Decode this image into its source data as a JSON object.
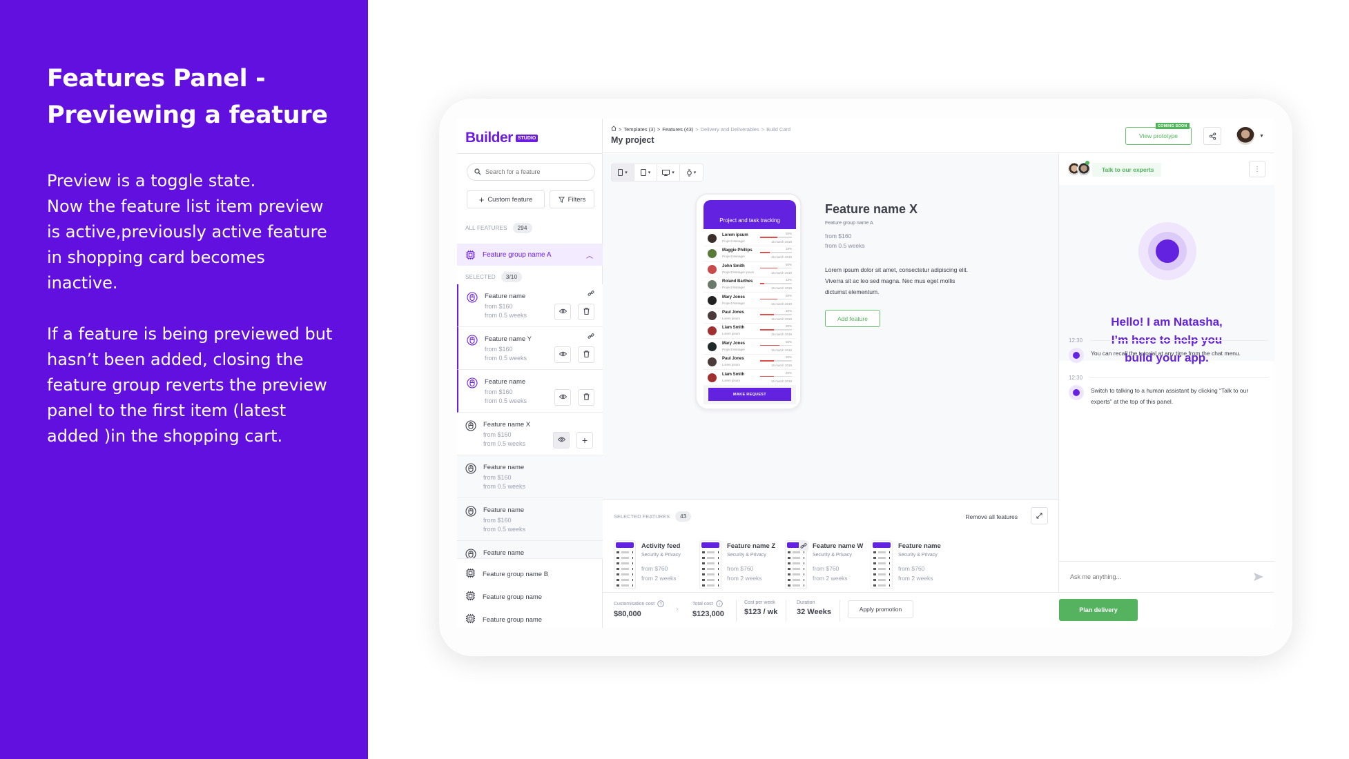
{
  "slide": {
    "title": "Features Panel - Previewing a feature",
    "paragraph1": "Preview is a toggle state.\nNow the feature list item preview is active,previously active feature in shopping card becomes inactive.",
    "paragraph2": "If a feature is being previewed but hasn’t been added, closing the feature group reverts the preview panel to the first item (latest added )in the shopping cart."
  },
  "brand": {
    "logo_text": "Builder",
    "logo_badge": "STUDIO",
    "accent": "#6c1ee0",
    "green": "#55b35f"
  },
  "header": {
    "breadcrumb": [
      "Templates (3)",
      "Features (43)",
      "Delivery and Deliverables",
      "Build Card"
    ],
    "project_title": "My project",
    "view_prototype": "View prototype",
    "coming_soon": "COMING SOON"
  },
  "sidebar": {
    "search_placeholder": "Search for a feature",
    "custom_feature": "Custom feature",
    "filters": "Filters",
    "all_features_label": "ALL FEATURES",
    "all_features_count": "294",
    "open_group": "Feature group name A",
    "selected_label": "SELECTED",
    "selected_count": "3/10",
    "features": [
      {
        "name": "Feature name",
        "price": "from $160",
        "duration": "from 0.5 weeks",
        "state": "selected",
        "linked": true
      },
      {
        "name": "Feature name Y",
        "price": "from $160",
        "duration": "from 0.5 weeks",
        "state": "selected",
        "linked": true
      },
      {
        "name": "Feature name",
        "price": "from $160",
        "duration": "from 0.5 weeks",
        "state": "selected",
        "linked": false
      },
      {
        "name": "Feature name X",
        "price": "from $160",
        "duration": "from 0.5 weeks",
        "state": "previewing",
        "linked": false
      },
      {
        "name": "Feature name",
        "price": "from $160",
        "duration": "from 0.5 weeks",
        "state": "unselected",
        "linked": false
      },
      {
        "name": "Feature name",
        "price": "from $160",
        "duration": "from 0.5 weeks",
        "state": "unselected",
        "linked": false
      },
      {
        "name": "Feature name",
        "price": "",
        "duration": "",
        "state": "unselected",
        "linked": false
      }
    ],
    "groups": [
      "Feature group name B",
      "Feature group name",
      "Feature group name"
    ]
  },
  "phone": {
    "header": "Project and task tracking",
    "rows": [
      {
        "name": "Lorem ipsum",
        "role": "Project Manager",
        "pct": "55%",
        "progress": 0.55,
        "date": "15 march 2019",
        "avatar": "#3a2e2a"
      },
      {
        "name": "Maggie Phillips",
        "role": "Project Manager",
        "pct": "18%",
        "progress": 0.3,
        "date": "15 march 2019",
        "avatar": "#5a7a3a"
      },
      {
        "name": "John Smith",
        "role": "Project Manager ipsum",
        "pct": "55%",
        "progress": 0.55,
        "date": "15 march 2019",
        "avatar": "#c94a4a"
      },
      {
        "name": "Roland Barthes",
        "role": "Project Manager",
        "pct": "13%",
        "progress": 0.13,
        "date": "15 march 2019",
        "avatar": "#6a7a6a"
      },
      {
        "name": "Mary Jones",
        "role": "Project Manager",
        "pct": "55%",
        "progress": 0.55,
        "date": "15 march 2019",
        "avatar": "#222222"
      },
      {
        "name": "Paul Jones",
        "role": "Lorem ipsum",
        "pct": "30%",
        "progress": 0.43,
        "date": "15 march 2019",
        "avatar": "#4a3a3a"
      },
      {
        "name": "Liam Smith",
        "role": "Lorem ipsum",
        "pct": "30%",
        "progress": 0.43,
        "date": "15 march 2019",
        "avatar": "#a03030"
      },
      {
        "name": "Mary Jones",
        "role": "Project Manager",
        "pct": "55%",
        "progress": 0.6,
        "date": "15 march 2019",
        "avatar": "#1e2a2a"
      },
      {
        "name": "Paul Jones",
        "role": "Lorem ipsum",
        "pct": "30%",
        "progress": 0.43,
        "date": "15 march 2019",
        "avatar": "#4a3a3a"
      },
      {
        "name": "Liam Smith",
        "role": "Lorem ipsum",
        "pct": "30%",
        "progress": 0.43,
        "date": "15 march 2019",
        "avatar": "#a03030"
      }
    ],
    "button": "MAKE REQUEST"
  },
  "preview": {
    "title": "Feature name X",
    "group": "Feature group name A",
    "price": "from $160",
    "duration": "from 0.5 weeks",
    "description": "Lorem ipsum dolor sit amet, consectetur adipiscing elit. Viverra sit ac leo sed magna. Nec mus eget mollis dictumst elementum.",
    "add_button": "Add feature"
  },
  "selected_features": {
    "label": "SELECTED FEATURES",
    "count": "43",
    "remove_all": "Remove all features",
    "cards": [
      {
        "name": "Activity feed",
        "category": "Security & Privacy",
        "price": "from $760",
        "duration": "from 2 weeks",
        "linked": false
      },
      {
        "name": "Feature name Z",
        "category": "Security & Privacy",
        "price": "from $760",
        "duration": "from 2 weeks",
        "linked": false
      },
      {
        "name": "Feature name W",
        "category": "Security & Privacy",
        "price": "from $760",
        "duration": "from 2 weeks",
        "linked": true
      },
      {
        "name": "Feature name",
        "category": "Security & Privacy",
        "price": "from $760",
        "duration": "from 2 weeks",
        "linked": false
      }
    ]
  },
  "footer": {
    "customisation_label": "Customisation cost",
    "customisation_value": "$80,000",
    "total_label": "Total cost",
    "total_value": "$123,000",
    "per_week_label": "Cost per week",
    "per_week_value": "$123 / wk",
    "duration_label": "Duration",
    "duration_value": "32 Weeks",
    "apply_promotion": "Apply promotion",
    "plan_delivery": "Plan delivery"
  },
  "chat": {
    "talk_experts": "Talk to our experts",
    "greeting": "Hello! I am Natasha, I’m here to help you build your app.",
    "messages": [
      {
        "time": "12:30",
        "text": "You can recall the tutorial at any time from the chat menu."
      },
      {
        "time": "12:30",
        "text": "Switch to talking to a human assistant by clicking “Talk to our experts” at the top of this panel."
      }
    ],
    "input_placeholder": "Ask me anything..."
  }
}
